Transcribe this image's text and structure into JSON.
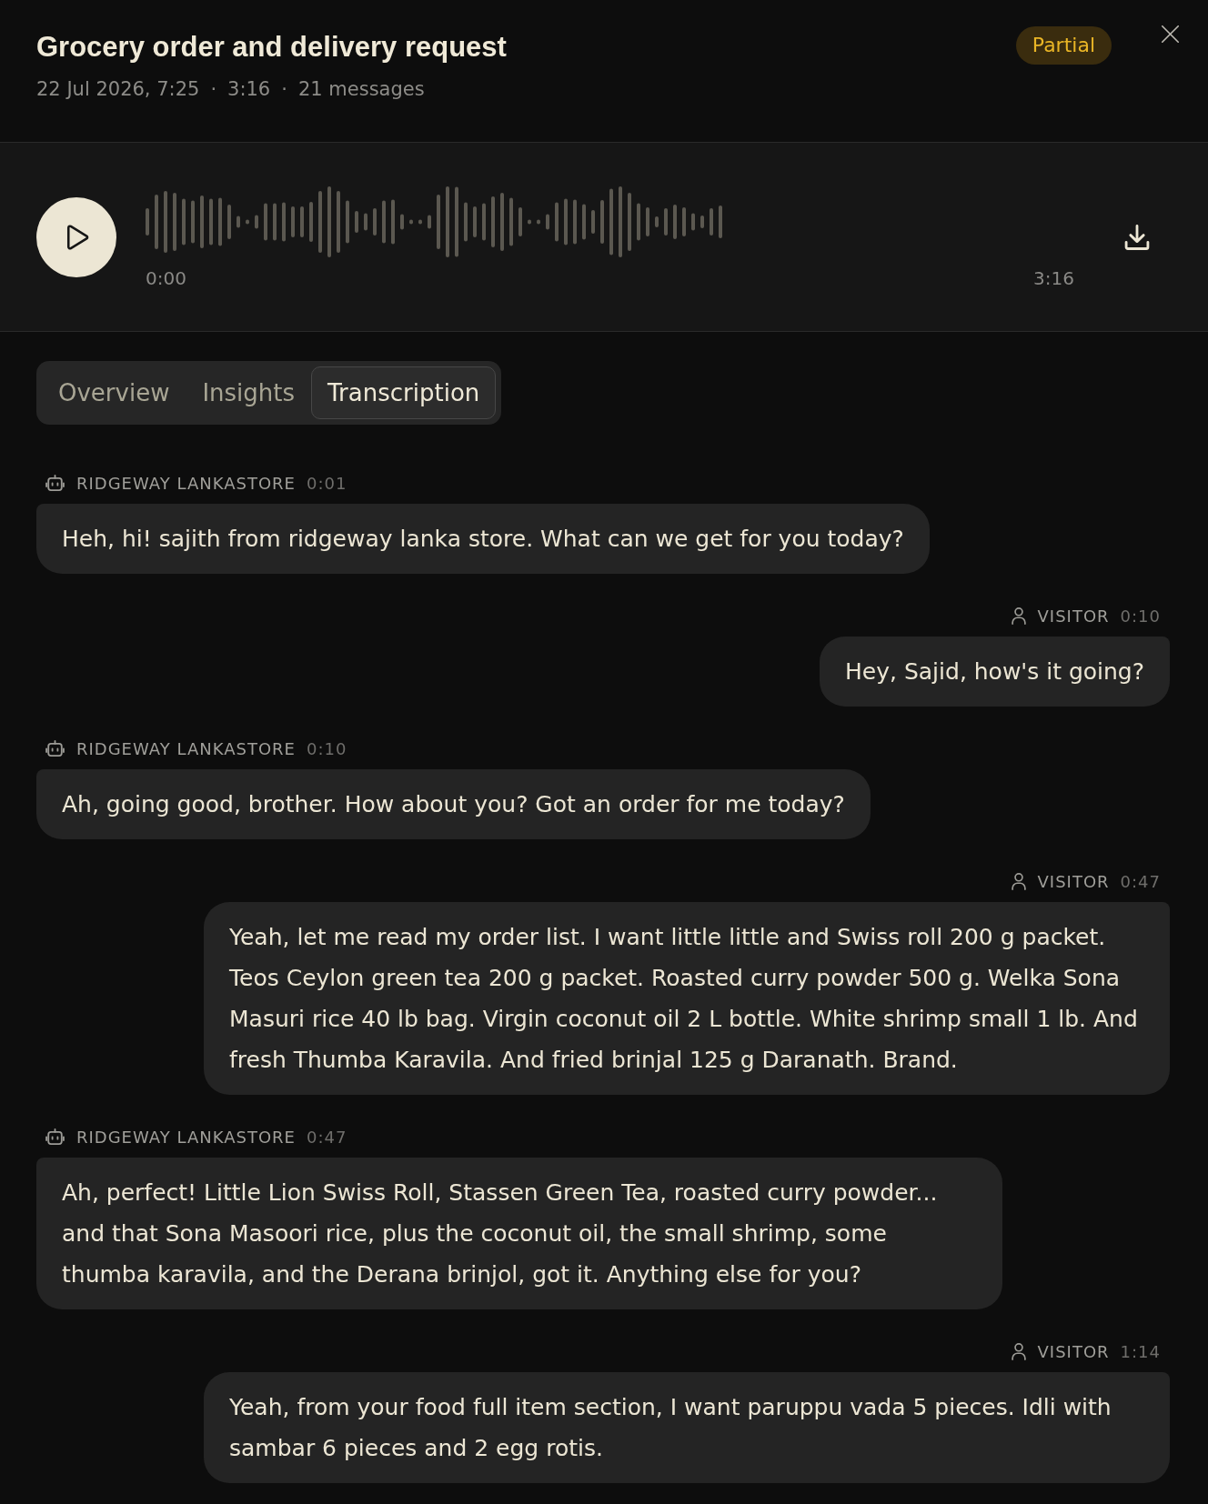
{
  "header": {
    "title": "Grocery order and delivery request",
    "meta": [
      {
        "text": "22 Jul 2026, 7:25"
      },
      {
        "separator": "·",
        "text": "3:16"
      },
      {
        "separator": "·",
        "text": "21 messages"
      }
    ],
    "status_badge": "Partial"
  },
  "player": {
    "start_time": "0:00",
    "end_time": "3:16"
  },
  "tabs": [
    {
      "label": "Overview",
      "selected": false
    },
    {
      "label": "Insights",
      "selected": false
    },
    {
      "label": "Transcription",
      "selected": true
    }
  ],
  "transcript": [
    {
      "kind": "agent",
      "speaker": "RIDGEWAY LANKASTORE",
      "time": "0:01",
      "text": "Heh, hi! sajith from ridgeway lanka store. What can we get for you today?"
    },
    {
      "kind": "visitor",
      "speaker": "VISITOR",
      "time": "0:10",
      "text": "Hey, Sajid, how's it going?"
    },
    {
      "kind": "agent",
      "speaker": "RIDGEWAY LANKASTORE",
      "time": "0:10",
      "text": "Ah, going good, brother. How about you? Got an order for me today?"
    },
    {
      "kind": "visitor",
      "speaker": "VISITOR",
      "time": "0:47",
      "text": "Yeah, let me read my order list. I want little little and Swiss roll 200 g packet. Teos Ceylon green tea 200 g packet. Roasted curry powder 500 g. Welka Sona Masuri rice 40 lb bag. Virgin coconut oil 2 L bottle. White shrimp small 1 lb. And fresh Thumba Karavila. And fried brinjal 125 g Daranath. Brand."
    },
    {
      "kind": "agent",
      "speaker": "RIDGEWAY LANKASTORE",
      "time": "0:47",
      "text": "Ah, perfect! Little Lion Swiss Roll, Stassen Green Tea, roasted curry powder... and that Sona Masoori rice, plus the coconut oil, the small shrimp, some thumba karavila, and the Derana brinjol, got it. Anything else for you?"
    },
    {
      "kind": "visitor",
      "speaker": "VISITOR",
      "time": "1:14",
      "text": "Yeah, from your food full item section, I want paruppu vada 5 pieces. Idli with sambar 6 pieces and 2 egg rotis."
    }
  ]
}
